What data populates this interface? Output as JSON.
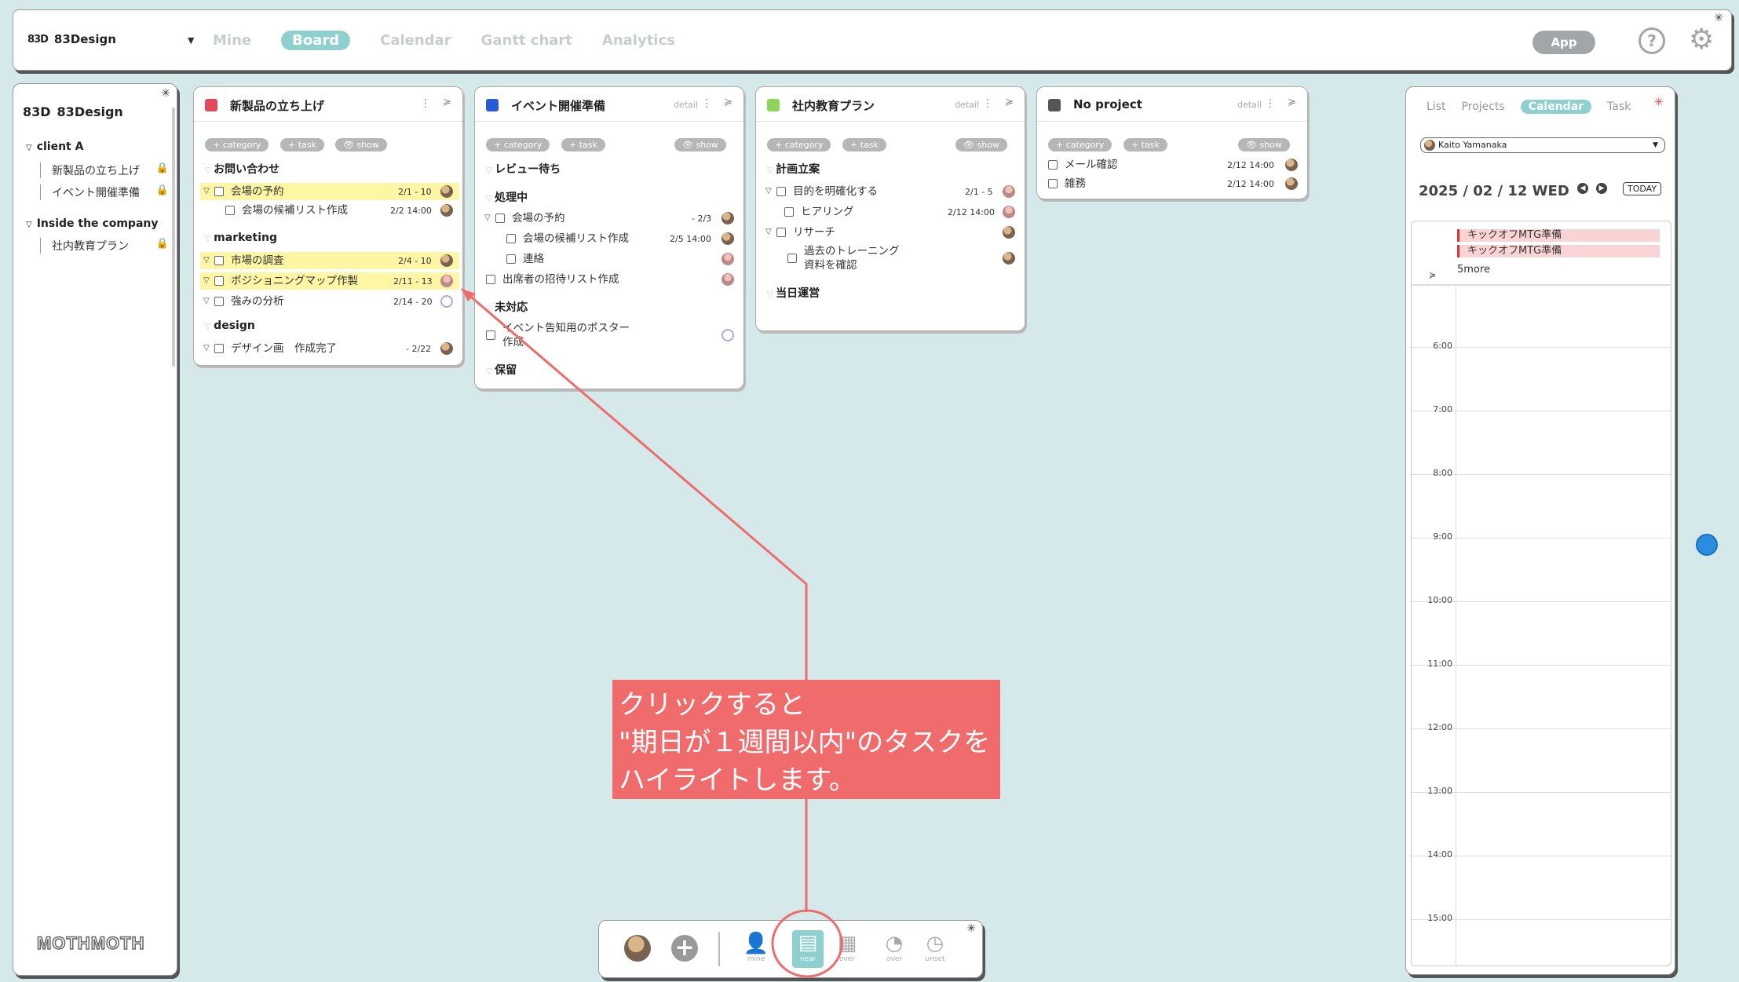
{
  "header": {
    "brand_logo": "83D",
    "brand_name": "83Design",
    "nav": [
      "Mine",
      "Board",
      "Calendar",
      "Gantt chart",
      "Analytics"
    ],
    "active_nav": "Board",
    "app_button": "App",
    "help_glyph": "?"
  },
  "sidebar": {
    "brand_logo": "83D",
    "brand_name": "83Design",
    "groups": [
      {
        "label": "client A",
        "items": [
          "新製品の立ち上げ",
          "イベント開催準備"
        ]
      },
      {
        "label": "Inside the company",
        "items": [
          "社内教育プラン"
        ]
      }
    ],
    "footer_logo": "MOTHMOTH"
  },
  "chips": {
    "category": "+ category",
    "task": "+ task",
    "show": "show"
  },
  "cards": [
    {
      "title": "新製品の立ち上げ",
      "color": "#e04a5a",
      "sections": [
        {
          "label": "お問い合わせ",
          "tasks": [
            {
              "label": "会場の予約",
              "date": "2/1 - 10",
              "highlight": true
            },
            {
              "label": "会場の候補リスト作成",
              "date": "2/2 14:00",
              "highlight": false
            }
          ]
        },
        {
          "label": "marketing",
          "tasks": [
            {
              "label": "市場の調査",
              "date": "2/4 - 10",
              "highlight": true
            },
            {
              "label": "ポジショニングマップ作製",
              "date": "2/11 - 13",
              "highlight": true
            },
            {
              "label": "強みの分析",
              "date": "2/14 - 20",
              "highlight": false
            }
          ]
        },
        {
          "label": "design",
          "tasks": [
            {
              "label": "デザイン画　作成完了",
              "date": "- 2/22",
              "highlight": false
            }
          ]
        }
      ]
    },
    {
      "title": "イベント開催準備",
      "color": "#2a5bd7",
      "detail": "detail",
      "sections": [
        {
          "label": "レビュー待ち",
          "tasks": []
        },
        {
          "label": "処理中",
          "tasks": [
            {
              "label": "会場の予約",
              "date": "- 2/3"
            },
            {
              "label": "会場の候補リスト作成",
              "date": "2/5 14:00"
            },
            {
              "label": "連絡",
              "date": ""
            },
            {
              "label": "出席者の招待リスト作成",
              "date": ""
            }
          ]
        },
        {
          "label": "未対応",
          "tasks": [
            {
              "label": "イベント告知用のポスター",
              "label2": "作成",
              "date": ""
            }
          ]
        },
        {
          "label": "保留",
          "tasks": []
        }
      ]
    },
    {
      "title": "社内教育プラン",
      "color": "#8ed65a",
      "detail": "detail",
      "sections": [
        {
          "label": "計画立案",
          "tasks": [
            {
              "label": "目的を明確化する",
              "date": "2/1 - 5"
            },
            {
              "label": "ヒアリング",
              "date": "2/12 14:00"
            },
            {
              "label": "リサーチ",
              "date": ""
            },
            {
              "label": "過去のトレーニング",
              "label2": "資料を確認",
              "date": ""
            }
          ]
        },
        {
          "label": "当日運営",
          "tasks": []
        }
      ]
    },
    {
      "title": "No project",
      "color": "#555555",
      "detail": "detail",
      "sections": [
        {
          "label": "",
          "tasks": [
            {
              "label": "メール確認",
              "date": "2/12 14:00"
            },
            {
              "label": "雑務",
              "date": "2/12 14:00"
            }
          ]
        }
      ]
    }
  ],
  "right_panel": {
    "tabs": [
      "List",
      "Projects",
      "Calendar",
      "Task"
    ],
    "active_tab": "Calendar",
    "user": "Kaito Yamanaka",
    "date": "2025 / 02 / 12 WED",
    "today_button": "TODAY",
    "all_day_events": [
      "キックオフMTG準備",
      "キックオフMTG準備"
    ],
    "more": "5more",
    "hours": [
      "6:00",
      "7:00",
      "8:00",
      "9:00",
      "10:00",
      "11:00",
      "12:00",
      "13:00",
      "14:00",
      "15:00"
    ]
  },
  "toolbar": {
    "items": [
      "mine",
      "near",
      "over",
      "over",
      "unset"
    ],
    "active": "near"
  },
  "annotation": {
    "lines": [
      "クリックすると",
      "\"期日が１週間以内\"のタスクを",
      "ハイライトします。"
    ],
    "color": "#f06c6c"
  }
}
